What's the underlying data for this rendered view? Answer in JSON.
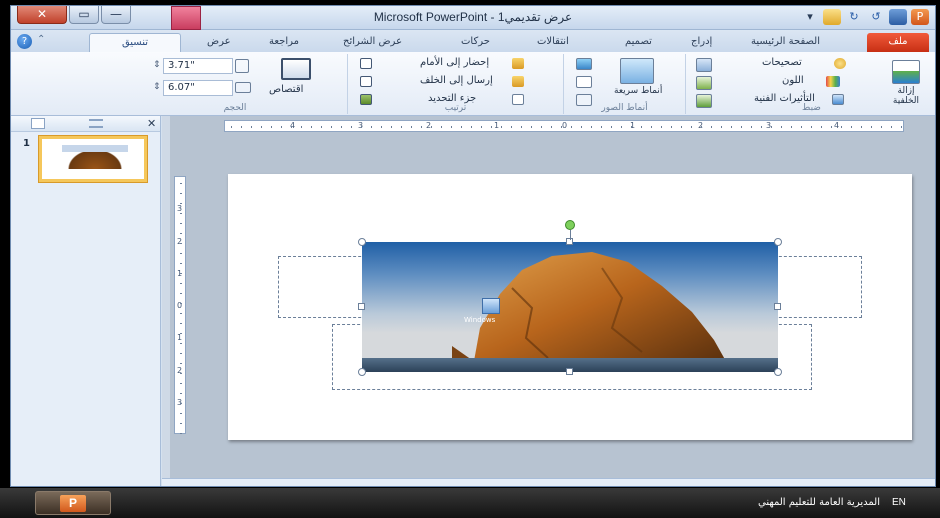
{
  "window": {
    "title": "Microsoft PowerPoint - عرض تقديمي1",
    "close_glyph": "✕",
    "max_glyph": "▭",
    "min_glyph": "—"
  },
  "tabs": {
    "file": "ملف",
    "home": "الصفحة الرئيسية",
    "insert": "إدراج",
    "design": "تصميم",
    "transitions": "انتقالات",
    "animations": "حركات",
    "slideshow": "عرض الشرائح",
    "review": "مراجعة",
    "view": "عرض",
    "format": "تنسيق"
  },
  "ribbon": {
    "adjust": {
      "label": "ضبط",
      "remove_bg": "إزالة الخلفية",
      "corrections": "تصحيحات",
      "color": "اللون",
      "artistic": "التأثيرات الفنية"
    },
    "styles": {
      "label": "أنماط الصور",
      "quick_styles": "أنماط سريعة"
    },
    "arrange": {
      "label": "ترتيب",
      "bring_forward": "إحضار إلى الأمام",
      "send_backward": "إرسال إلى الخلف",
      "selection_pane": "جزء التحديد"
    },
    "size": {
      "label": "الحجم",
      "crop": "اقتصاص",
      "height": "3.71\"",
      "width": "6.07\""
    }
  },
  "slides_pane": {
    "slide_number": "1",
    "close_glyph": "✕"
  },
  "ruler": {
    "h_labels": [
      "4",
      "3",
      "2",
      "1",
      "0",
      "1",
      "2",
      "3",
      "4"
    ],
    "v_labels": [
      "3",
      "2",
      "1",
      "0",
      "1",
      "2",
      "3"
    ]
  },
  "picture": {
    "icon_label": "Windows"
  },
  "taskbar": {
    "app_letter": "P",
    "language": "EN",
    "org": "المديرية العامة للتعليم المهني"
  },
  "colors": {
    "file_tab": "#d8401f",
    "tools_tab": "#d64b6d",
    "selection_frame": "#f5c75b",
    "rotate_handle": "#7ed05c"
  }
}
